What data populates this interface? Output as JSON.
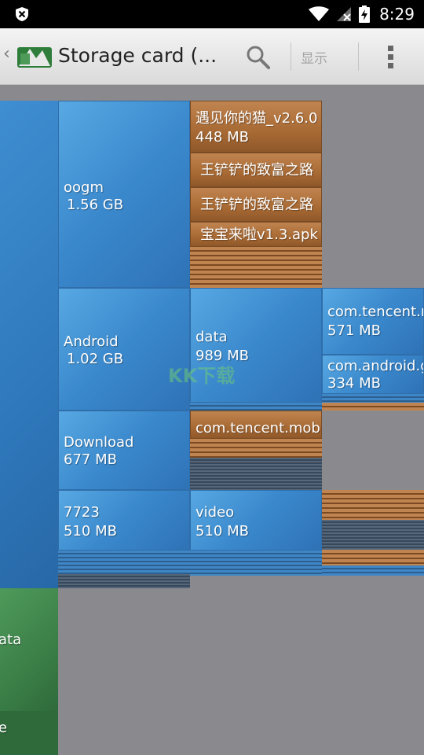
{
  "status_bar": {
    "time": "8:29"
  },
  "action_bar": {
    "title": "Storage card (...",
    "display_label": "显示",
    "icons": [
      "back-chevron-icon",
      "diskusage-logo-icon",
      "search-icon",
      "overflow-menu-icon"
    ]
  },
  "colors": {
    "folder": "#3a88cc",
    "file": "#a86a34",
    "green": "#3b7f47",
    "empty": "#8a898e"
  },
  "tiles": {
    "left_top_label": "ata",
    "left_bottom_label": "e",
    "oogm": {
      "name": "oogm",
      "size": "1.56 GB"
    },
    "android": {
      "name": "Android",
      "size": "1.02 GB"
    },
    "download": {
      "name": "Download",
      "size": "677 MB"
    },
    "t7723": {
      "name": "7723",
      "size": "510 MB"
    },
    "cat": {
      "name": "遇见你的猫_v2.6.0",
      "size": "448 MB"
    },
    "wang1": {
      "name": "王铲铲的致富之路"
    },
    "wang2": {
      "name": "王铲铲的致富之路"
    },
    "baobao": {
      "name": "宝宝来啦v1.3.apk"
    },
    "data": {
      "name": "data",
      "size": "989 MB"
    },
    "tencent_m": {
      "name": "com.tencent.m",
      "size": "571 MB"
    },
    "android_g": {
      "name": "com.android.g",
      "size": "334 MB"
    },
    "tencent_mob": {
      "name": "com.tencent.mob"
    },
    "video": {
      "name": "video",
      "size": "510 MB"
    }
  },
  "watermark": "KK下载"
}
